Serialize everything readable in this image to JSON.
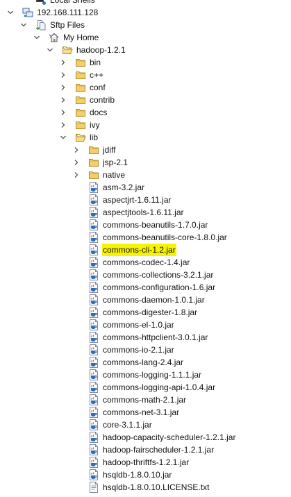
{
  "tree": [
    {
      "label": "Local Shells",
      "level": 1,
      "icon": "local-shells-icon",
      "toggle": "none",
      "name": "tree-item-local-shells"
    },
    {
      "label": "192.168.111.128",
      "level": 0,
      "icon": "connection-icon",
      "toggle": "expanded",
      "name": "tree-item-host"
    },
    {
      "label": "Sftp Files",
      "level": 1,
      "icon": "sftp-files-icon",
      "toggle": "expanded",
      "name": "tree-item-sftp-files"
    },
    {
      "label": "My Home",
      "level": 2,
      "icon": "home-icon",
      "toggle": "expanded",
      "name": "tree-item-my-home"
    },
    {
      "label": "hadoop-1.2.1",
      "level": 3,
      "icon": "folder-open-icon",
      "toggle": "expanded",
      "name": "tree-item-hadoop-1.2.1"
    },
    {
      "label": "bin",
      "level": 4,
      "icon": "folder-icon",
      "toggle": "collapsed",
      "name": "tree-item-bin"
    },
    {
      "label": "c++",
      "level": 4,
      "icon": "folder-icon",
      "toggle": "collapsed",
      "name": "tree-item-cpp"
    },
    {
      "label": "conf",
      "level": 4,
      "icon": "folder-icon",
      "toggle": "collapsed",
      "name": "tree-item-conf"
    },
    {
      "label": "contrib",
      "level": 4,
      "icon": "folder-icon",
      "toggle": "collapsed",
      "name": "tree-item-contrib"
    },
    {
      "label": "docs",
      "level": 4,
      "icon": "folder-icon",
      "toggle": "collapsed",
      "name": "tree-item-docs"
    },
    {
      "label": "ivy",
      "level": 4,
      "icon": "folder-icon",
      "toggle": "collapsed",
      "name": "tree-item-ivy"
    },
    {
      "label": "lib",
      "level": 4,
      "icon": "folder-open-icon",
      "toggle": "expanded",
      "name": "tree-item-lib"
    },
    {
      "label": "jdiff",
      "level": 5,
      "icon": "folder-icon",
      "toggle": "collapsed",
      "name": "tree-item-jdiff"
    },
    {
      "label": "jsp-2.1",
      "level": 5,
      "icon": "folder-icon",
      "toggle": "collapsed",
      "name": "tree-item-jsp-2.1"
    },
    {
      "label": "native",
      "level": 5,
      "icon": "folder-icon",
      "toggle": "collapsed",
      "name": "tree-item-native"
    },
    {
      "label": "asm-3.2.jar",
      "level": 5,
      "icon": "jar-file-icon",
      "toggle": "none",
      "name": "tree-item-jar"
    },
    {
      "label": "aspectjrt-1.6.11.jar",
      "level": 5,
      "icon": "jar-file-icon",
      "toggle": "none",
      "name": "tree-item-jar"
    },
    {
      "label": "aspectjtools-1.6.11.jar",
      "level": 5,
      "icon": "jar-file-icon",
      "toggle": "none",
      "name": "tree-item-jar"
    },
    {
      "label": "commons-beanutils-1.7.0.jar",
      "level": 5,
      "icon": "jar-file-icon",
      "toggle": "none",
      "name": "tree-item-jar"
    },
    {
      "label": "commons-beanutils-core-1.8.0.jar",
      "level": 5,
      "icon": "jar-file-icon",
      "toggle": "none",
      "name": "tree-item-jar"
    },
    {
      "label": "commons-cli-1.2.jar",
      "level": 5,
      "icon": "jar-file-icon",
      "toggle": "none",
      "highlight": true,
      "name": "tree-item-commons-cli-1.2-jar"
    },
    {
      "label": "commons-codec-1.4.jar",
      "level": 5,
      "icon": "jar-file-icon",
      "toggle": "none",
      "name": "tree-item-jar"
    },
    {
      "label": "commons-collections-3.2.1.jar",
      "level": 5,
      "icon": "jar-file-icon",
      "toggle": "none",
      "name": "tree-item-jar"
    },
    {
      "label": "commons-configuration-1.6.jar",
      "level": 5,
      "icon": "jar-file-icon",
      "toggle": "none",
      "name": "tree-item-jar"
    },
    {
      "label": "commons-daemon-1.0.1.jar",
      "level": 5,
      "icon": "jar-file-icon",
      "toggle": "none",
      "name": "tree-item-jar"
    },
    {
      "label": "commons-digester-1.8.jar",
      "level": 5,
      "icon": "jar-file-icon",
      "toggle": "none",
      "name": "tree-item-jar"
    },
    {
      "label": "commons-el-1.0.jar",
      "level": 5,
      "icon": "jar-file-icon",
      "toggle": "none",
      "name": "tree-item-jar"
    },
    {
      "label": "commons-httpclient-3.0.1.jar",
      "level": 5,
      "icon": "jar-file-icon",
      "toggle": "none",
      "name": "tree-item-jar"
    },
    {
      "label": "commons-io-2.1.jar",
      "level": 5,
      "icon": "jar-file-icon",
      "toggle": "none",
      "name": "tree-item-jar"
    },
    {
      "label": "commons-lang-2.4.jar",
      "level": 5,
      "icon": "jar-file-icon",
      "toggle": "none",
      "name": "tree-item-jar"
    },
    {
      "label": "commons-logging-1.1.1.jar",
      "level": 5,
      "icon": "jar-file-icon",
      "toggle": "none",
      "name": "tree-item-jar"
    },
    {
      "label": "commons-logging-api-1.0.4.jar",
      "level": 5,
      "icon": "jar-file-icon",
      "toggle": "none",
      "name": "tree-item-jar"
    },
    {
      "label": "commons-math-2.1.jar",
      "level": 5,
      "icon": "jar-file-icon",
      "toggle": "none",
      "name": "tree-item-jar"
    },
    {
      "label": "commons-net-3.1.jar",
      "level": 5,
      "icon": "jar-file-icon",
      "toggle": "none",
      "name": "tree-item-jar"
    },
    {
      "label": "core-3.1.1.jar",
      "level": 5,
      "icon": "jar-file-icon",
      "toggle": "none",
      "name": "tree-item-jar"
    },
    {
      "label": "hadoop-capacity-scheduler-1.2.1.jar",
      "level": 5,
      "icon": "jar-file-icon",
      "toggle": "none",
      "name": "tree-item-jar"
    },
    {
      "label": "hadoop-fairscheduler-1.2.1.jar",
      "level": 5,
      "icon": "jar-file-icon",
      "toggle": "none",
      "name": "tree-item-jar"
    },
    {
      "label": "hadoop-thriftfs-1.2.1.jar",
      "level": 5,
      "icon": "jar-file-icon",
      "toggle": "none",
      "name": "tree-item-jar"
    },
    {
      "label": "hsqldb-1.8.0.10.jar",
      "level": 5,
      "icon": "jar-file-icon",
      "toggle": "none",
      "name": "tree-item-jar"
    },
    {
      "label": "hsqldb-1.8.0.10.LICENSE.txt",
      "level": 5,
      "icon": "text-file-icon",
      "toggle": "none",
      "name": "tree-item-text-file"
    }
  ],
  "colors": {
    "highlight": "#f7f400",
    "folder_fill": "#f3cf6c",
    "folder_stroke": "#b08a2a",
    "toggle_arrow": "#555555"
  }
}
